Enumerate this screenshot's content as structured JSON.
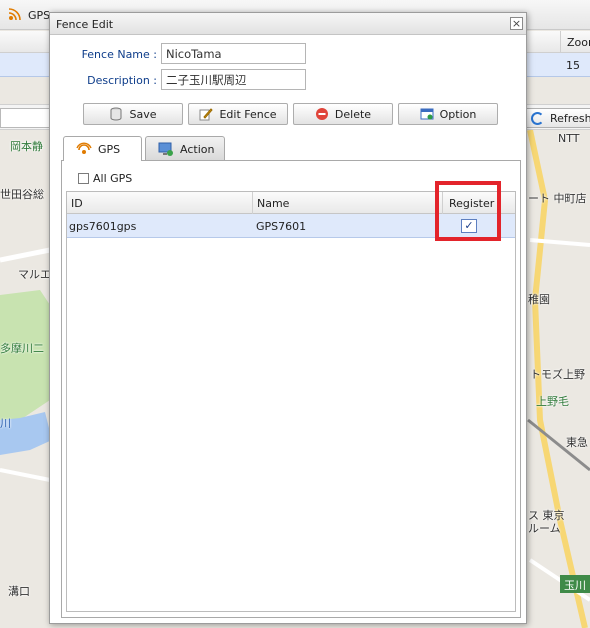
{
  "background_app": {
    "title": "GPS",
    "grid": {
      "zoom_header": "Zoom",
      "zoom_value": "15"
    },
    "refresh_label": "Refresh"
  },
  "map_labels": {
    "okamoto": "岡本静",
    "setagaya": "世田谷総",
    "maru": "マルエ",
    "tamagawa": "多摩川二",
    "ntt": "NTT",
    "nakamachi": "ート 中町店",
    "suiran": "稚園",
    "tomozu": "トモズ上野",
    "kaminoge": "上野毛",
    "tokyu": "東急",
    "tokyo_bldg": "ス 東京",
    "room": "ルーム",
    "mizoguchi": "溝口",
    "kawa": "川",
    "tamagawa_sign": "玉川"
  },
  "dialog": {
    "title": "Fence Edit",
    "close_glyph": "×",
    "fence_name_label": "Fence Name :",
    "fence_name_value": "NicoTama",
    "description_label": "Description :",
    "description_value": "二子玉川駅周辺",
    "buttons": {
      "save": "Save",
      "edit_fence": "Edit Fence",
      "delete": "Delete",
      "option": "Option"
    },
    "tabs": {
      "gps": "GPS",
      "action": "Action"
    },
    "all_gps_label": "All GPS",
    "grid": {
      "columns": {
        "id": "ID",
        "name": "Name",
        "register": "Register"
      },
      "rows": [
        {
          "id": "gps7601gps",
          "name": "GPS7601",
          "registered": true
        }
      ]
    },
    "checkmark": "✓"
  },
  "colors": {
    "highlight": "#e3242b",
    "selected_row": "#dfe9fb",
    "label_blue": "#0d3c8a"
  }
}
